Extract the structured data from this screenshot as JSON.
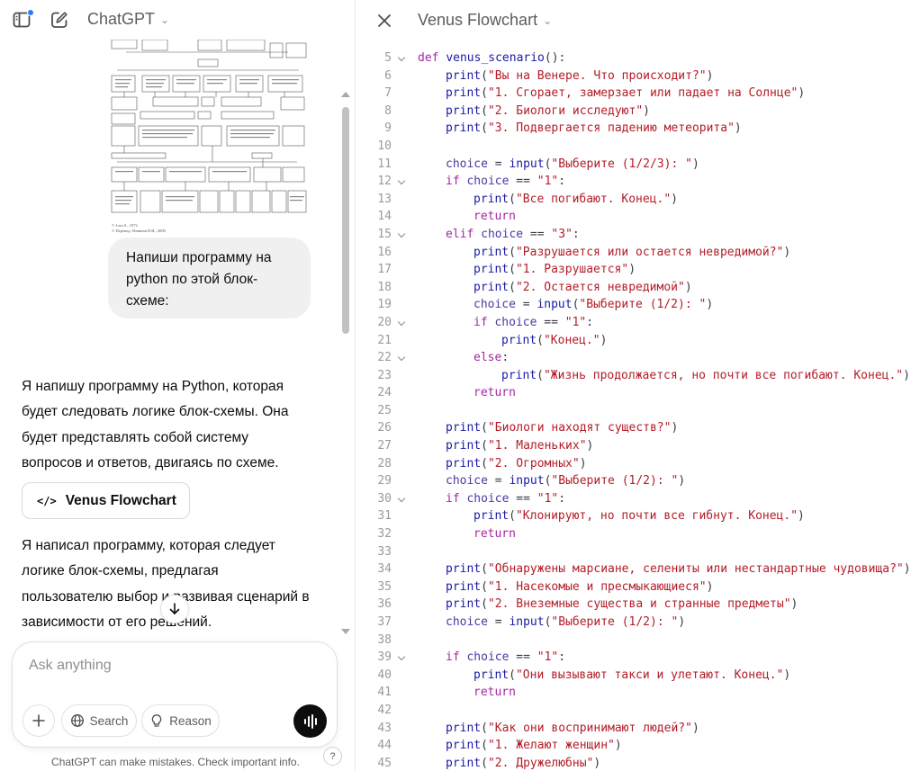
{
  "left_pane": {
    "model_name": "ChatGPT",
    "user_message": "Напиши программу на python по этой блок-схеме:",
    "assistant_para1": "Я напишу программу на Python, которая будет следовать логике блок-схемы. Она будет представлять собой систему вопросов и ответов, двигаясь по схеме.",
    "canvas_chip_label": "Venus Flowchart",
    "assistant_para2": "Я написал программу, которая следует логике блок-схемы, предлагая пользователю выбор и развивая сценарий в зависимости от его решений.",
    "composer_placeholder": "Ask anything",
    "search_label": "Search",
    "reason_label": "Reason",
    "footer_note": "ChatGPT can make mistakes. Check important info.",
    "help_label": "?",
    "flowchart_caption_1": "© Lem S., 1972",
    "flowchart_caption_2": "© Перевод: Язвинов В.И., 2000",
    "icons": [
      "sidebar-icon",
      "new-chat-icon",
      "chevron-down-icon",
      "code-icon",
      "arrow-down-icon",
      "plus-icon",
      "globe-icon",
      "lightbulb-icon",
      "voice-icon"
    ]
  },
  "right_pane": {
    "doc_title": "Venus Flowchart",
    "code_lines": [
      {
        "n": "5",
        "fold": true,
        "indent": 0,
        "tokens": [
          [
            "kw",
            "def "
          ],
          [
            "fn",
            "venus_scenario"
          ],
          [
            "p",
            "():"
          ]
        ]
      },
      {
        "n": "6",
        "fold": false,
        "indent": 1,
        "tokens": [
          [
            "fn",
            "print"
          ],
          [
            "p",
            "("
          ],
          [
            "str",
            "\"Вы на Венере. Что происходит?\""
          ],
          [
            "p",
            ")"
          ]
        ]
      },
      {
        "n": "7",
        "fold": false,
        "indent": 1,
        "tokens": [
          [
            "fn",
            "print"
          ],
          [
            "p",
            "("
          ],
          [
            "str",
            "\"1. Сгорает, замерзает или падает на Солнце\""
          ],
          [
            "p",
            ")"
          ]
        ]
      },
      {
        "n": "8",
        "fold": false,
        "indent": 1,
        "tokens": [
          [
            "fn",
            "print"
          ],
          [
            "p",
            "("
          ],
          [
            "str",
            "\"2. Биологи исследуют\""
          ],
          [
            "p",
            ")"
          ]
        ]
      },
      {
        "n": "9",
        "fold": false,
        "indent": 1,
        "tokens": [
          [
            "fn",
            "print"
          ],
          [
            "p",
            "("
          ],
          [
            "str",
            "\"3. Подвергается падению метеорита\""
          ],
          [
            "p",
            ")"
          ]
        ]
      },
      {
        "n": "10",
        "fold": false,
        "indent": 0,
        "tokens": []
      },
      {
        "n": "11",
        "fold": false,
        "indent": 1,
        "tokens": [
          [
            "var",
            "choice"
          ],
          [
            "p",
            " = "
          ],
          [
            "fn",
            "input"
          ],
          [
            "p",
            "("
          ],
          [
            "str",
            "\"Выберите (1/2/3): \""
          ],
          [
            "p",
            ")"
          ]
        ]
      },
      {
        "n": "12",
        "fold": true,
        "indent": 1,
        "tokens": [
          [
            "kw",
            "if "
          ],
          [
            "var",
            "choice"
          ],
          [
            "p",
            " == "
          ],
          [
            "str",
            "\"1\""
          ],
          [
            "p",
            ":"
          ]
        ]
      },
      {
        "n": "13",
        "fold": false,
        "indent": 2,
        "tokens": [
          [
            "fn",
            "print"
          ],
          [
            "p",
            "("
          ],
          [
            "str",
            "\"Все погибают. Конец.\""
          ],
          [
            "p",
            ")"
          ]
        ]
      },
      {
        "n": "14",
        "fold": false,
        "indent": 2,
        "tokens": [
          [
            "kw",
            "return"
          ]
        ]
      },
      {
        "n": "15",
        "fold": true,
        "indent": 1,
        "tokens": [
          [
            "kw",
            "elif "
          ],
          [
            "var",
            "choice"
          ],
          [
            "p",
            " == "
          ],
          [
            "str",
            "\"3\""
          ],
          [
            "p",
            ":"
          ]
        ]
      },
      {
        "n": "16",
        "fold": false,
        "indent": 2,
        "tokens": [
          [
            "fn",
            "print"
          ],
          [
            "p",
            "("
          ],
          [
            "str",
            "\"Разрушается или остается невредимой?\""
          ],
          [
            "p",
            ")"
          ]
        ]
      },
      {
        "n": "17",
        "fold": false,
        "indent": 2,
        "tokens": [
          [
            "fn",
            "print"
          ],
          [
            "p",
            "("
          ],
          [
            "str",
            "\"1. Разрушается\""
          ],
          [
            "p",
            ")"
          ]
        ]
      },
      {
        "n": "18",
        "fold": false,
        "indent": 2,
        "tokens": [
          [
            "fn",
            "print"
          ],
          [
            "p",
            "("
          ],
          [
            "str",
            "\"2. Остается невредимой\""
          ],
          [
            "p",
            ")"
          ]
        ]
      },
      {
        "n": "19",
        "fold": false,
        "indent": 2,
        "tokens": [
          [
            "var",
            "choice"
          ],
          [
            "p",
            " = "
          ],
          [
            "fn",
            "input"
          ],
          [
            "p",
            "("
          ],
          [
            "str",
            "\"Выберите (1/2): \""
          ],
          [
            "p",
            ")"
          ]
        ]
      },
      {
        "n": "20",
        "fold": true,
        "indent": 2,
        "tokens": [
          [
            "kw",
            "if "
          ],
          [
            "var",
            "choice"
          ],
          [
            "p",
            " == "
          ],
          [
            "str",
            "\"1\""
          ],
          [
            "p",
            ":"
          ]
        ]
      },
      {
        "n": "21",
        "fold": false,
        "indent": 3,
        "tokens": [
          [
            "fn",
            "print"
          ],
          [
            "p",
            "("
          ],
          [
            "str",
            "\"Конец.\""
          ],
          [
            "p",
            ")"
          ]
        ]
      },
      {
        "n": "22",
        "fold": true,
        "indent": 2,
        "tokens": [
          [
            "kw",
            "else"
          ],
          [
            "p",
            ":"
          ]
        ]
      },
      {
        "n": "23",
        "fold": false,
        "indent": 3,
        "tokens": [
          [
            "fn",
            "print"
          ],
          [
            "p",
            "("
          ],
          [
            "str",
            "\"Жизнь продолжается, но почти все погибают. Конец.\""
          ],
          [
            "p",
            ")"
          ]
        ]
      },
      {
        "n": "24",
        "fold": false,
        "indent": 2,
        "tokens": [
          [
            "kw",
            "return"
          ]
        ]
      },
      {
        "n": "25",
        "fold": false,
        "indent": 0,
        "tokens": []
      },
      {
        "n": "26",
        "fold": false,
        "indent": 1,
        "tokens": [
          [
            "fn",
            "print"
          ],
          [
            "p",
            "("
          ],
          [
            "str",
            "\"Биологи находят существ?\""
          ],
          [
            "p",
            ")"
          ]
        ]
      },
      {
        "n": "27",
        "fold": false,
        "indent": 1,
        "tokens": [
          [
            "fn",
            "print"
          ],
          [
            "p",
            "("
          ],
          [
            "str",
            "\"1. Маленьких\""
          ],
          [
            "p",
            ")"
          ]
        ]
      },
      {
        "n": "28",
        "fold": false,
        "indent": 1,
        "tokens": [
          [
            "fn",
            "print"
          ],
          [
            "p",
            "("
          ],
          [
            "str",
            "\"2. Огромных\""
          ],
          [
            "p",
            ")"
          ]
        ]
      },
      {
        "n": "29",
        "fold": false,
        "indent": 1,
        "tokens": [
          [
            "var",
            "choice"
          ],
          [
            "p",
            " = "
          ],
          [
            "fn",
            "input"
          ],
          [
            "p",
            "("
          ],
          [
            "str",
            "\"Выберите (1/2): \""
          ],
          [
            "p",
            ")"
          ]
        ]
      },
      {
        "n": "30",
        "fold": true,
        "indent": 1,
        "tokens": [
          [
            "kw",
            "if "
          ],
          [
            "var",
            "choice"
          ],
          [
            "p",
            " == "
          ],
          [
            "str",
            "\"1\""
          ],
          [
            "p",
            ":"
          ]
        ]
      },
      {
        "n": "31",
        "fold": false,
        "indent": 2,
        "tokens": [
          [
            "fn",
            "print"
          ],
          [
            "p",
            "("
          ],
          [
            "str",
            "\"Клонируют, но почти все гибнут. Конец.\""
          ],
          [
            "p",
            ")"
          ]
        ]
      },
      {
        "n": "32",
        "fold": false,
        "indent": 2,
        "tokens": [
          [
            "kw",
            "return"
          ]
        ]
      },
      {
        "n": "33",
        "fold": false,
        "indent": 0,
        "tokens": []
      },
      {
        "n": "34",
        "fold": false,
        "indent": 1,
        "tokens": [
          [
            "fn",
            "print"
          ],
          [
            "p",
            "("
          ],
          [
            "str",
            "\"Обнаружены марсиане, селениты или нестандартные чудовища?\""
          ],
          [
            "p",
            ")"
          ]
        ]
      },
      {
        "n": "35",
        "fold": false,
        "indent": 1,
        "tokens": [
          [
            "fn",
            "print"
          ],
          [
            "p",
            "("
          ],
          [
            "str",
            "\"1. Насекомые и пресмыкающиеся\""
          ],
          [
            "p",
            ")"
          ]
        ]
      },
      {
        "n": "36",
        "fold": false,
        "indent": 1,
        "tokens": [
          [
            "fn",
            "print"
          ],
          [
            "p",
            "("
          ],
          [
            "str",
            "\"2. Внеземные существа и странные предметы\""
          ],
          [
            "p",
            ")"
          ]
        ]
      },
      {
        "n": "37",
        "fold": false,
        "indent": 1,
        "tokens": [
          [
            "var",
            "choice"
          ],
          [
            "p",
            " = "
          ],
          [
            "fn",
            "input"
          ],
          [
            "p",
            "("
          ],
          [
            "str",
            "\"Выберите (1/2): \""
          ],
          [
            "p",
            ")"
          ]
        ]
      },
      {
        "n": "38",
        "fold": false,
        "indent": 0,
        "tokens": []
      },
      {
        "n": "39",
        "fold": true,
        "indent": 1,
        "tokens": [
          [
            "kw",
            "if "
          ],
          [
            "var",
            "choice"
          ],
          [
            "p",
            " == "
          ],
          [
            "str",
            "\"1\""
          ],
          [
            "p",
            ":"
          ]
        ]
      },
      {
        "n": "40",
        "fold": false,
        "indent": 2,
        "tokens": [
          [
            "fn",
            "print"
          ],
          [
            "p",
            "("
          ],
          [
            "str",
            "\"Они вызывают такси и улетают. Конец.\""
          ],
          [
            "p",
            ")"
          ]
        ]
      },
      {
        "n": "41",
        "fold": false,
        "indent": 2,
        "tokens": [
          [
            "kw",
            "return"
          ]
        ]
      },
      {
        "n": "42",
        "fold": false,
        "indent": 0,
        "tokens": []
      },
      {
        "n": "43",
        "fold": false,
        "indent": 1,
        "tokens": [
          [
            "fn",
            "print"
          ],
          [
            "p",
            "("
          ],
          [
            "str",
            "\"Как они воспринимают людей?\""
          ],
          [
            "p",
            ")"
          ]
        ]
      },
      {
        "n": "44",
        "fold": false,
        "indent": 1,
        "tokens": [
          [
            "fn",
            "print"
          ],
          [
            "p",
            "("
          ],
          [
            "str",
            "\"1. Желают женщин\""
          ],
          [
            "p",
            ")"
          ]
        ]
      },
      {
        "n": "45",
        "fold": false,
        "indent": 1,
        "tokens": [
          [
            "fn",
            "print"
          ],
          [
            "p",
            "("
          ],
          [
            "str",
            "\"2. Дружелюбны\""
          ],
          [
            "p",
            ")"
          ]
        ]
      }
    ]
  },
  "colors": {
    "keyword": "#a626a4",
    "string": "#b31d28",
    "function": "#1a1aa6",
    "variable": "#4a3aa3",
    "line_number": "#9a9a9a",
    "user_bubble": "#f0f0f0",
    "accent_dot": "#2b7cff"
  }
}
